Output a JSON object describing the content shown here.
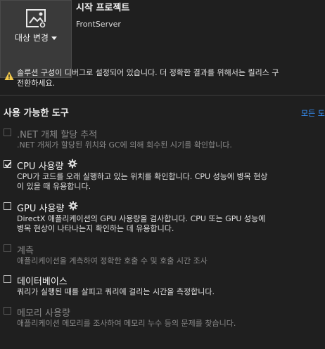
{
  "header": {
    "target_button_label": "대상 변경",
    "title": "시작 프로젝트",
    "project": "FrontServer"
  },
  "warning": {
    "line1": "솔루션 구성이 디버그로 설정되어 있습니다. 더 정확한 결과를 위해서는 릴리스 구",
    "line2": "전환하세요."
  },
  "tools_section": {
    "title": "사용 가능한 도구",
    "show_all": "모든 도"
  },
  "tools": [
    {
      "name": ".NET 개체 할당 추적",
      "desc": ".NET 개체가 할당된 위치와 GC에 의해 회수된 시기를 확인합니다.",
      "checked": false,
      "enabled": false,
      "gear": false
    },
    {
      "name": "CPU 사용량",
      "desc": "CPU가 코드를 오래 실행하고 있는 위치를 확인합니다. CPU 성능에 병목 현상이 있을 때 유용합니다.",
      "checked": true,
      "enabled": true,
      "gear": true
    },
    {
      "name": "GPU 사용량",
      "desc": "DirectX 애플리케이션의 GPU 사용량을 검사합니다. CPU 또는 GPU 성능에 병목 현상이 나타나는지 확인하는 데 유용합니다.",
      "checked": false,
      "enabled": true,
      "gear": true
    },
    {
      "name": "계측",
      "desc": "애플리케이션을 계측하여 정확한 호출 수 및 호출 시간 조사",
      "checked": false,
      "enabled": false,
      "gear": false
    },
    {
      "name": "데이터베이스",
      "desc": "쿼리가 실행된 때를 살피고 쿼리에 걸리는 시간을 측정합니다.",
      "checked": false,
      "enabled": true,
      "gear": false
    },
    {
      "name": "메모리 사용량",
      "desc": "애플리케이션 메모리를 조사하여 메모리 누수 등의 문제를 찾습니다.",
      "checked": false,
      "enabled": false,
      "gear": false
    }
  ]
}
